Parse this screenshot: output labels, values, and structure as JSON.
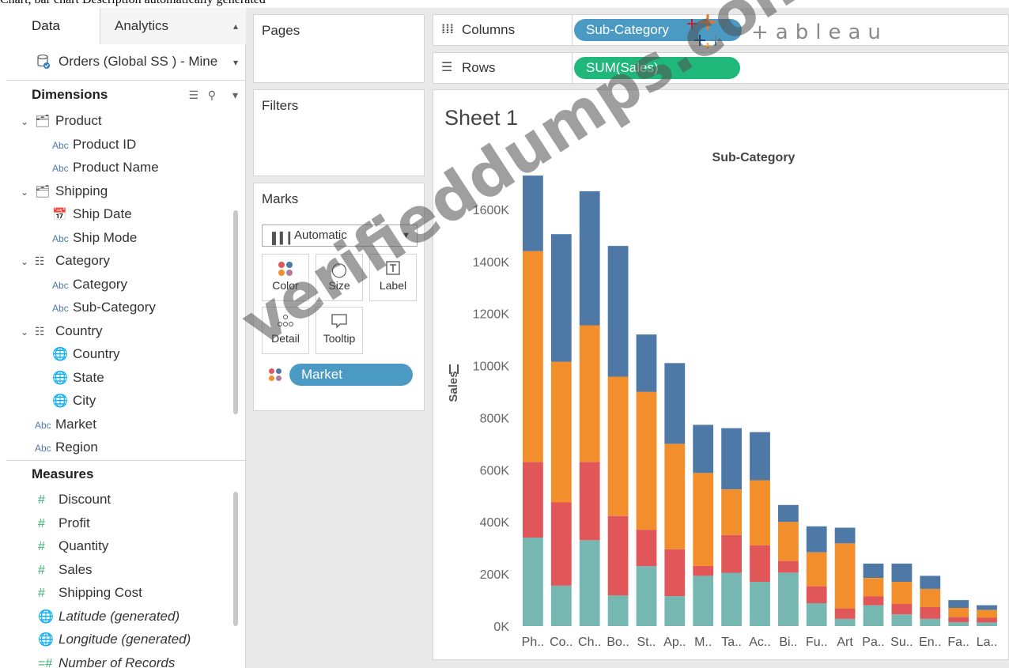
{
  "caption": "Chart, bar chart Description automatically generated",
  "tabs": {
    "data": "Data",
    "analytics": "Analytics"
  },
  "datasource": "Orders (Global SS ) - Mine",
  "dimensions": {
    "title": "Dimensions",
    "fields": [
      {
        "label": "Product",
        "kind": "folder",
        "indent": 0
      },
      {
        "label": "Product ID",
        "kind": "abc",
        "indent": 1
      },
      {
        "label": "Product Name",
        "kind": "abc",
        "indent": 1
      },
      {
        "label": "Shipping",
        "kind": "folder",
        "indent": 0
      },
      {
        "label": "Ship Date",
        "kind": "date",
        "indent": 1
      },
      {
        "label": "Ship Mode",
        "kind": "abc",
        "indent": 1
      },
      {
        "label": "Category",
        "kind": "hierarchy",
        "indent": 0
      },
      {
        "label": "Category",
        "kind": "abc",
        "indent": 1
      },
      {
        "label": "Sub-Category",
        "kind": "abc",
        "indent": 1
      },
      {
        "label": "Country",
        "kind": "hierarchy",
        "indent": 0
      },
      {
        "label": "Country",
        "kind": "geo",
        "indent": 1
      },
      {
        "label": "State",
        "kind": "geo",
        "indent": 1
      },
      {
        "label": "City",
        "kind": "geo",
        "indent": 1
      },
      {
        "label": "Market",
        "kind": "abc",
        "indent": -1
      },
      {
        "label": "Region",
        "kind": "abc",
        "indent": -1
      }
    ]
  },
  "abc_text": "Abc",
  "measures": {
    "title": "Measures",
    "fields": [
      {
        "label": "Discount",
        "kind": "meas",
        "italic": false
      },
      {
        "label": "Profit",
        "kind": "meas",
        "italic": false
      },
      {
        "label": "Quantity",
        "kind": "meas",
        "italic": false
      },
      {
        "label": "Sales",
        "kind": "meas",
        "italic": false
      },
      {
        "label": "Shipping Cost",
        "kind": "meas",
        "italic": false
      },
      {
        "label": "Latitude (generated)",
        "kind": "geo-m",
        "italic": true
      },
      {
        "label": "Longitude (generated)",
        "kind": "geo-m",
        "italic": true
      },
      {
        "label": "Number of Records",
        "kind": "meas-calc",
        "italic": true
      }
    ]
  },
  "cards": {
    "pages": "Pages",
    "filters": "Filters",
    "marks": "Marks"
  },
  "marks": {
    "type": "Automatic",
    "buttons": [
      "Color",
      "Size",
      "Label",
      "Detail",
      "Tooltip"
    ],
    "pill": "Market"
  },
  "shelves": {
    "columns_label": "Columns",
    "columns_pill": "Sub-Category",
    "rows_label": "Rows",
    "rows_pill": "SUM(Sales)"
  },
  "sheet_title": "Sheet 1",
  "logo_text": "+ableau",
  "watermark": "verifieddumps.com",
  "colors": {
    "blue": "#4e79a7",
    "orange": "#f28e2b",
    "red": "#e15759",
    "teal": "#76b7b2",
    "pill_blue": "#4b9ac4",
    "pill_green": "#1fb87a"
  },
  "chart_data": {
    "type": "bar",
    "stacked": true,
    "title": "Sub-Category",
    "ylabel": "Sales",
    "ylim": [
      0,
      1700000
    ],
    "yticks": [
      0,
      200000,
      400000,
      600000,
      800000,
      1000000,
      1200000,
      1400000,
      1600000
    ],
    "ytick_labels": [
      "0K",
      "200K",
      "400K",
      "600K",
      "800K",
      "1000K",
      "1200K",
      "1400K",
      "1600K"
    ],
    "categories": [
      "Ph..",
      "Co..",
      "Ch..",
      "Bo..",
      "St..",
      "Ap..",
      "M..",
      "Ta..",
      "Ac..",
      "Bi..",
      "Fu..",
      "Art",
      "Pa..",
      "Su..",
      "En..",
      "Fa..",
      "La.."
    ],
    "series": [
      {
        "color": "#76b7b2",
        "values": [
          340000,
          155000,
          330000,
          118000,
          230000,
          115000,
          193000,
          205000,
          170000,
          205000,
          88000,
          28000,
          80000,
          45000,
          28000,
          15000,
          14000
        ]
      },
      {
        "color": "#e15759",
        "values": [
          290000,
          320000,
          300000,
          305000,
          140000,
          180000,
          38000,
          145000,
          140000,
          45000,
          65000,
          40000,
          35000,
          40000,
          45000,
          20000,
          18000
        ]
      },
      {
        "color": "#f28e2b",
        "values": [
          810000,
          540000,
          525000,
          535000,
          530000,
          405000,
          357000,
          175000,
          250000,
          150000,
          130000,
          250000,
          70000,
          85000,
          70000,
          35000,
          30000
        ]
      },
      {
        "color": "#4e79a7",
        "values": [
          290000,
          490000,
          515000,
          502000,
          220000,
          310000,
          185000,
          235000,
          185000,
          65000,
          100000,
          60000,
          55000,
          70000,
          50000,
          30000,
          18000
        ]
      }
    ]
  }
}
